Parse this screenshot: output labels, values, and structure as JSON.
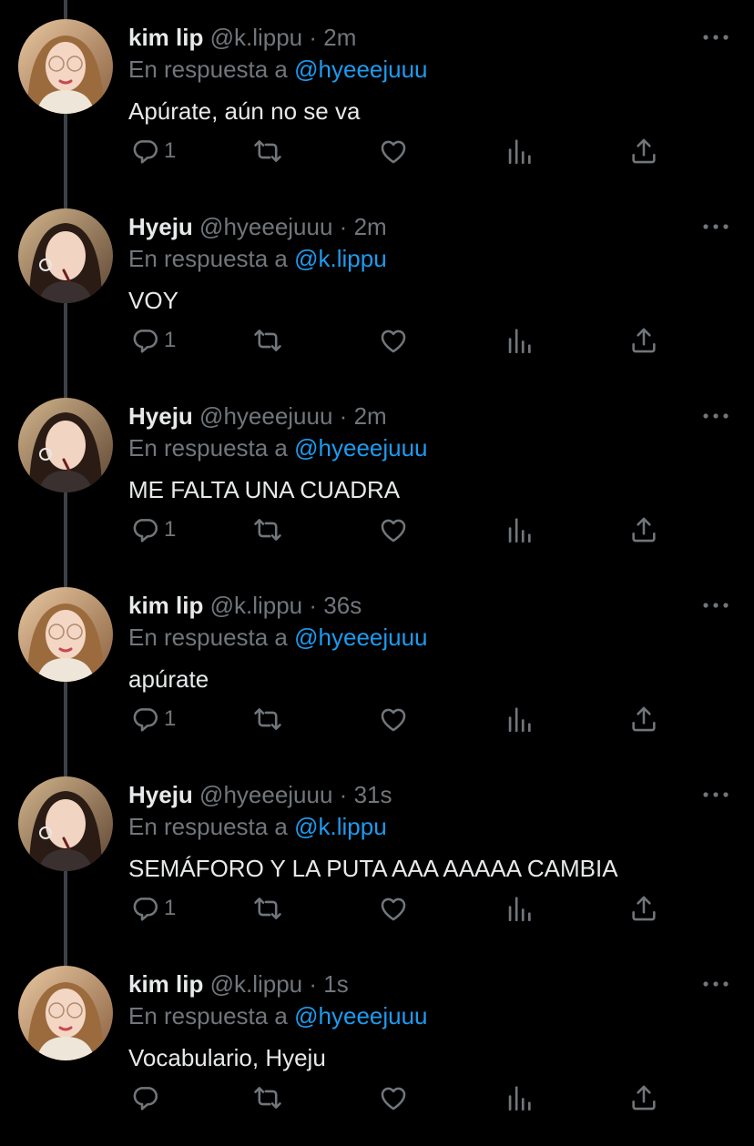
{
  "labels": {
    "replying_to": "En respuesta a",
    "separator": "·"
  },
  "colors": {
    "background": "#000000",
    "text": "#e7e9ea",
    "muted": "#71767b",
    "link": "#1d9bf0",
    "thread_line": "#3d4147"
  },
  "icons": {
    "reply": "reply-icon",
    "retweet": "retweet-icon",
    "like": "heart-icon",
    "stats": "stats-icon",
    "share": "share-icon",
    "more": "more-icon"
  },
  "tweets": [
    {
      "name": "kim lip",
      "handle": "@k.lippu",
      "time": "2m",
      "reply_to": "@hyeeejuuu",
      "text": "Apúrate, aún no se va",
      "replies": "1"
    },
    {
      "name": "Hyeju",
      "handle": "@hyeeejuuu",
      "time": "2m",
      "reply_to": "@k.lippu",
      "text": "VOY",
      "replies": "1"
    },
    {
      "name": "Hyeju",
      "handle": "@hyeeejuuu",
      "time": "2m",
      "reply_to": "@hyeeejuuu",
      "text": "ME FALTA UNA CUADRA",
      "replies": "1"
    },
    {
      "name": "kim lip",
      "handle": "@k.lippu",
      "time": "36s",
      "reply_to": "@hyeeejuuu",
      "text": "apúrate",
      "replies": "1"
    },
    {
      "name": "Hyeju",
      "handle": "@hyeeejuuu",
      "time": "31s",
      "reply_to": "@k.lippu",
      "text": "SEMÁFORO Y LA PUTA AAA AAAAA CAMBIA",
      "replies": "1"
    },
    {
      "name": "kim lip",
      "handle": "@k.lippu",
      "time": "1s",
      "reply_to": "@hyeeejuuu",
      "text": "Vocabulario, Hyeju",
      "replies": ""
    }
  ]
}
